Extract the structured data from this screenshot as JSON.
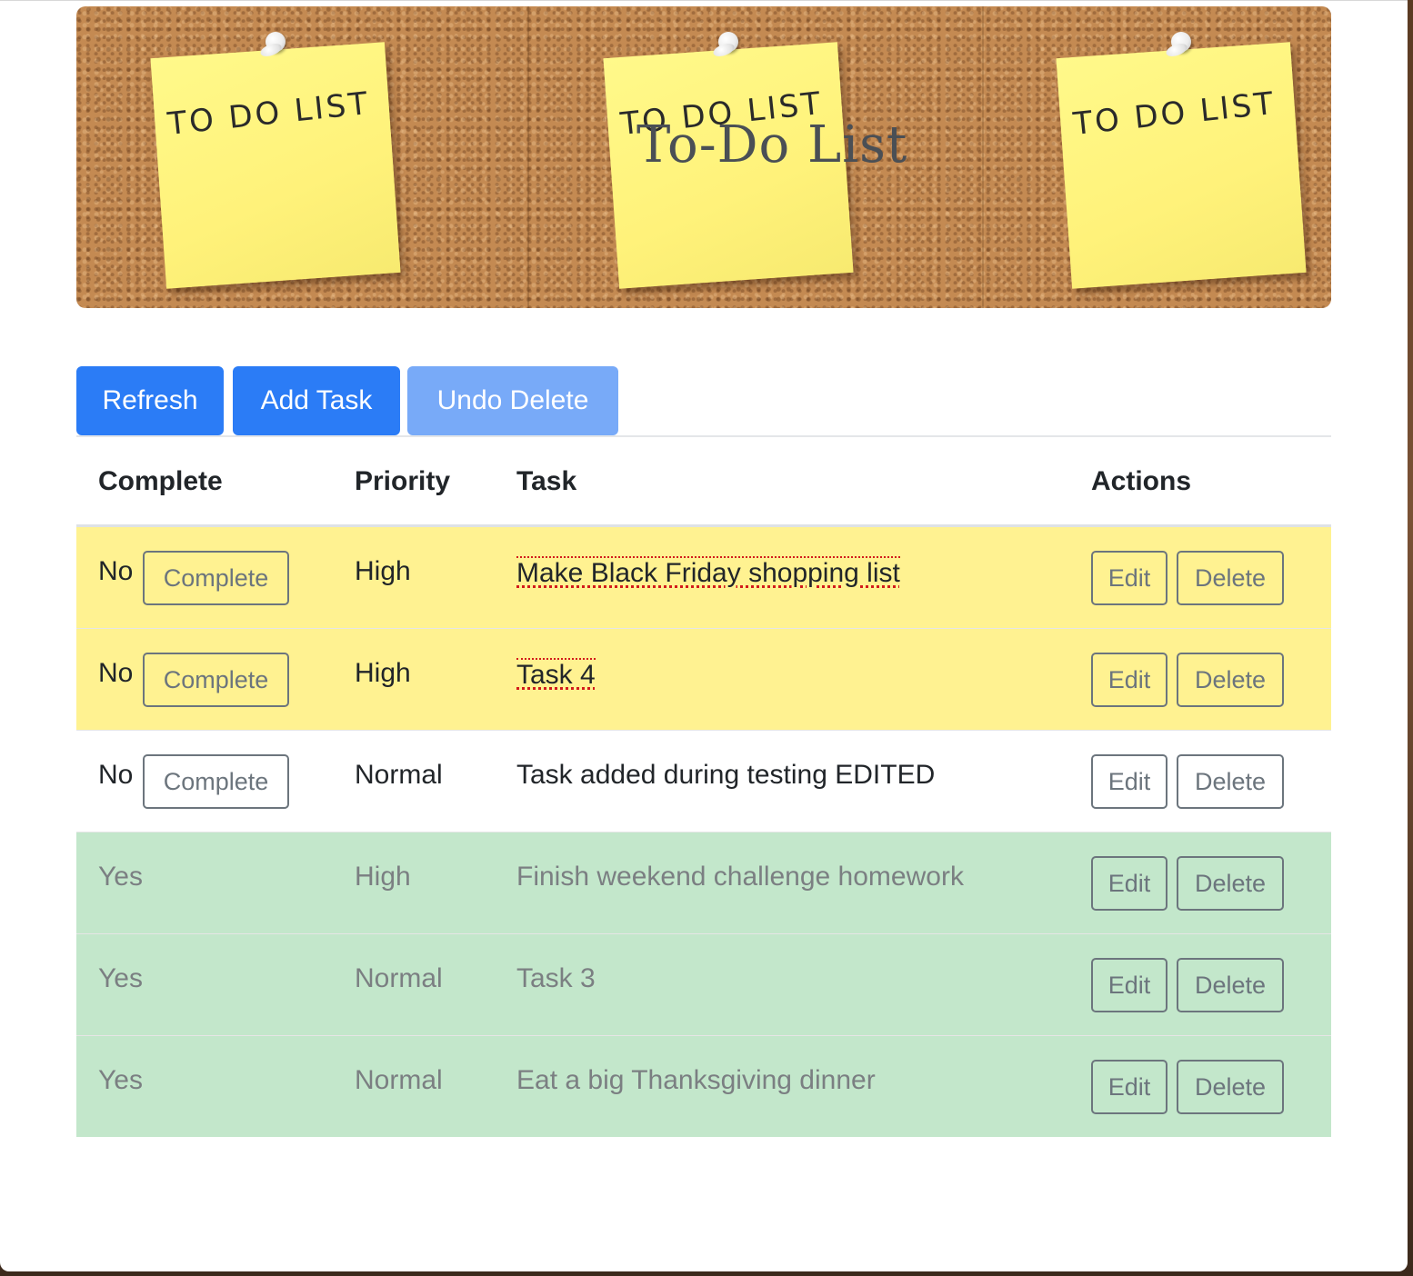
{
  "banner": {
    "title": "To-Do List",
    "notes": [
      "TO DO LIST",
      "TO DO LIST",
      "TO DO LIST"
    ]
  },
  "toolbar": {
    "refresh_label": "Refresh",
    "add_label": "Add Task",
    "undo_label": "Undo Delete"
  },
  "table": {
    "headers": {
      "complete": "Complete",
      "priority": "Priority",
      "task": "Task",
      "actions": "Actions"
    },
    "complete_button": "Complete",
    "edit_button": "Edit",
    "delete_button": "Delete",
    "rows": [
      {
        "complete": "No",
        "priority": "High",
        "task": "Make Black Friday shopping list",
        "status": "pending-high"
      },
      {
        "complete": "No",
        "priority": "High",
        "task": "Task 4",
        "status": "pending-high"
      },
      {
        "complete": "No",
        "priority": "Normal",
        "task": "Task added during testing EDITED",
        "status": "pending-normal"
      },
      {
        "complete": "Yes",
        "priority": "High",
        "task": "Finish weekend challenge homework",
        "status": "done"
      },
      {
        "complete": "Yes",
        "priority": "Normal",
        "task": "Task 3",
        "status": "done"
      },
      {
        "complete": "Yes",
        "priority": "Normal",
        "task": "Eat a big Thanksgiving dinner",
        "status": "done"
      }
    ]
  },
  "colors": {
    "primary": "#2b7cf6",
    "primary_disabled": "#78aaf8",
    "pending_high_row": "#fff291",
    "done_row": "#c3e7cb"
  }
}
